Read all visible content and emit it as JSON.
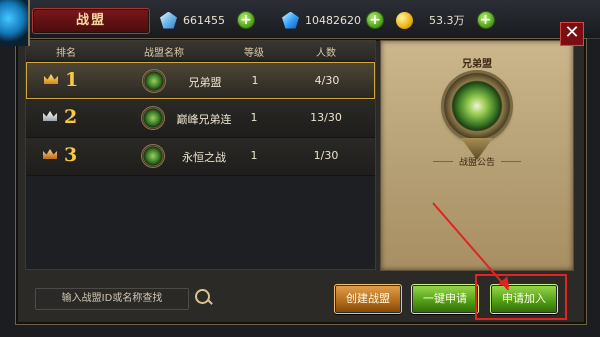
{
  "header": {
    "title": "战盟",
    "resources": [
      {
        "icon": "diamond-icon",
        "value": "661455"
      },
      {
        "icon": "blue-diamond-icon",
        "value": "10482620"
      },
      {
        "icon": "gold-coin-icon",
        "value": "53.3万"
      }
    ]
  },
  "table": {
    "headers": [
      "排名",
      "战盟名称",
      "等级",
      "人数"
    ],
    "rows": [
      {
        "rank": "1",
        "name": "兄弟盟",
        "level": "1",
        "members": "4/30",
        "selected": true
      },
      {
        "rank": "2",
        "name": "巅峰兄弟连",
        "level": "1",
        "members": "13/30",
        "selected": false
      },
      {
        "rank": "3",
        "name": "永恒之战",
        "level": "1",
        "members": "1/30",
        "selected": false
      }
    ]
  },
  "detail": {
    "guild_name": "兄弟盟",
    "notice_label": "战盟公告"
  },
  "bottom": {
    "search_placeholder": "输入战盟ID或名称查找",
    "create_label": "创建战盟",
    "one_click_apply_label": "一键申请",
    "apply_join_label": "申请加入"
  },
  "colors": {
    "highlight": "#e32222",
    "accent_gold": "#d1a63f",
    "btn_green": "#4f9c14",
    "btn_orange": "#b26b1a"
  }
}
